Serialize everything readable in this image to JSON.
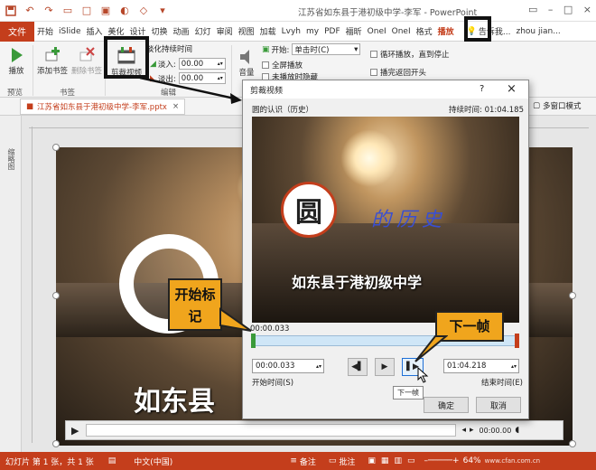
{
  "window": {
    "title": "江苏省如东县于港初级中学-李军 - PowerPoint",
    "tell_me": "告诉我...",
    "user": "zhou jian..."
  },
  "tabs": [
    "文件",
    "开始",
    "iSlide",
    "插入",
    "美化",
    "设计",
    "切换",
    "动画",
    "幻灯",
    "审阅",
    "视图",
    "加载",
    "Lvyh",
    "my",
    "PDF",
    "福昕",
    "OneI",
    "OneI",
    "格式",
    "播放"
  ],
  "ribbon": {
    "play": "播放",
    "add_bookmark": "添加书签",
    "remove_bookmark": "删除书签",
    "trim_video": "剪裁视频",
    "fade_duration": "淡化持续时间",
    "fade_in": "淡入:",
    "fade_in_value": "00.00",
    "fade_out": "淡出:",
    "fade_out_value": "00.00",
    "volume": "音量",
    "start": "开始:",
    "start_value": "单击时(C)",
    "fullscreen": "全屏播放",
    "hide_not_playing": "未播放时隐藏",
    "loop": "循环播放，直到停止",
    "rewind": "播完返回开头",
    "group_preview": "预览",
    "group_bookmarks": "书签",
    "group_edit": "编辑"
  },
  "doc_tab": "江苏省如东县于港初级中学-李军.pptx",
  "multi_window": "多窗口模式",
  "slide": {
    "left_text": "如东县",
    "time": "00:00.00"
  },
  "dialog": {
    "title": "剪裁视频",
    "help": "?",
    "close": "×",
    "video_name": "圆的认识（历史）",
    "duration": "持续时间: 01:04.185",
    "video_title": "的历史",
    "video_subtitle": "如东县于港初级中学",
    "logo_char": "圆",
    "current_time": "00:00.033",
    "start_time": "00:00.033",
    "start_label": "开始时间(S)",
    "end_time": "01:04.218",
    "end_label": "结束时间(E)",
    "tooltip": "下一帧",
    "ok": "确定",
    "cancel": "取消"
  },
  "callouts": {
    "start_marker": "开始标记",
    "next_frame": "下一帧"
  },
  "status": {
    "slide_info": "幻灯片 第 1 张，共 1 张",
    "language": "中文(中国)",
    "notes": "备注",
    "comments": "批注",
    "zoom": "64%",
    "watermark": "www.cfan.com.cn"
  }
}
